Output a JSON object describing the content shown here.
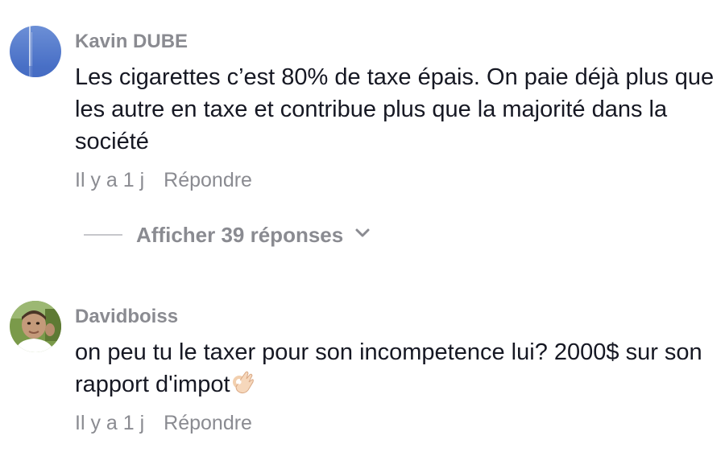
{
  "comments": [
    {
      "username": "Kavin DUBE",
      "avatar_icon": "avatar-photo",
      "text": "Les cigarettes c’est 80% de taxe épais. On paie déjà plus que les autre en taxe et contribue plus que la majorité dans la société",
      "time": "Il y a 1 j",
      "reply_label": "Répondre",
      "view_replies_label": "Afficher 39 réponses",
      "view_replies_icon": "chevron-down-icon"
    },
    {
      "username": "Davidboiss",
      "avatar_icon": "avatar-photo",
      "text": "on peu tu le taxer pour son incompetence lui? 2000$ sur son rapport d'impot",
      "text_emoji": "ok-hand-emoji",
      "time": "Il y a 1 j",
      "reply_label": "Répondre"
    }
  ],
  "colors": {
    "text": "#161823",
    "secondary": "#8a8b91",
    "divider": "#c6c7cb"
  }
}
